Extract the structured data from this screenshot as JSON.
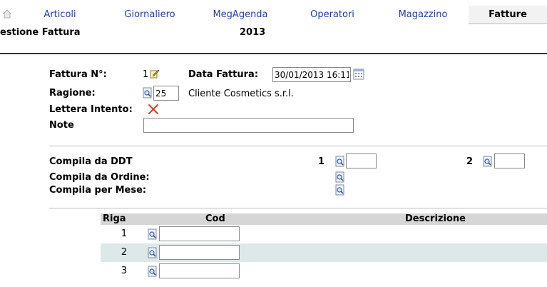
{
  "tabs": [
    {
      "label": "Articoli"
    },
    {
      "label": "Giornaliero"
    },
    {
      "label": "MegAgenda"
    },
    {
      "label": "Operatori"
    },
    {
      "label": "Magazzino"
    },
    {
      "label": "Fatture"
    }
  ],
  "active_tab": "Fatture",
  "header": {
    "title": "estione Fattura",
    "year": "2013"
  },
  "form": {
    "invoice_no_label": "Fattura N°:",
    "invoice_no": "1",
    "date_label": "Data Fattura:",
    "date_value": "30/01/2013 16:11",
    "customer_label": "Ragione:",
    "customer_code": "25",
    "customer_name": "Cliente Cosmetics s.r.l.",
    "intent_label": "Lettera Intento:",
    "notes_label": "Note",
    "notes_value": ""
  },
  "fill": {
    "ddt_label": "Compila da DDT",
    "ddt_1_label": "1",
    "ddt_2_label": "2",
    "ddt_1_value": "",
    "ddt_2_value": "",
    "order_label": "Compila da Ordine:",
    "month_label": "Compila per Mese:"
  },
  "grid": {
    "columns": [
      "Riga",
      "Cod",
      "Descrizione"
    ],
    "rows": [
      {
        "riga": "1",
        "cod": ""
      },
      {
        "riga": "2",
        "cod": ""
      },
      {
        "riga": "3",
        "cod": ""
      }
    ]
  },
  "colors": {
    "tab_link": "#1f3fa8",
    "row_alt": "#dde9e9",
    "header_bg": "#d6d6d6",
    "remove_icon": "#e03a1c"
  }
}
